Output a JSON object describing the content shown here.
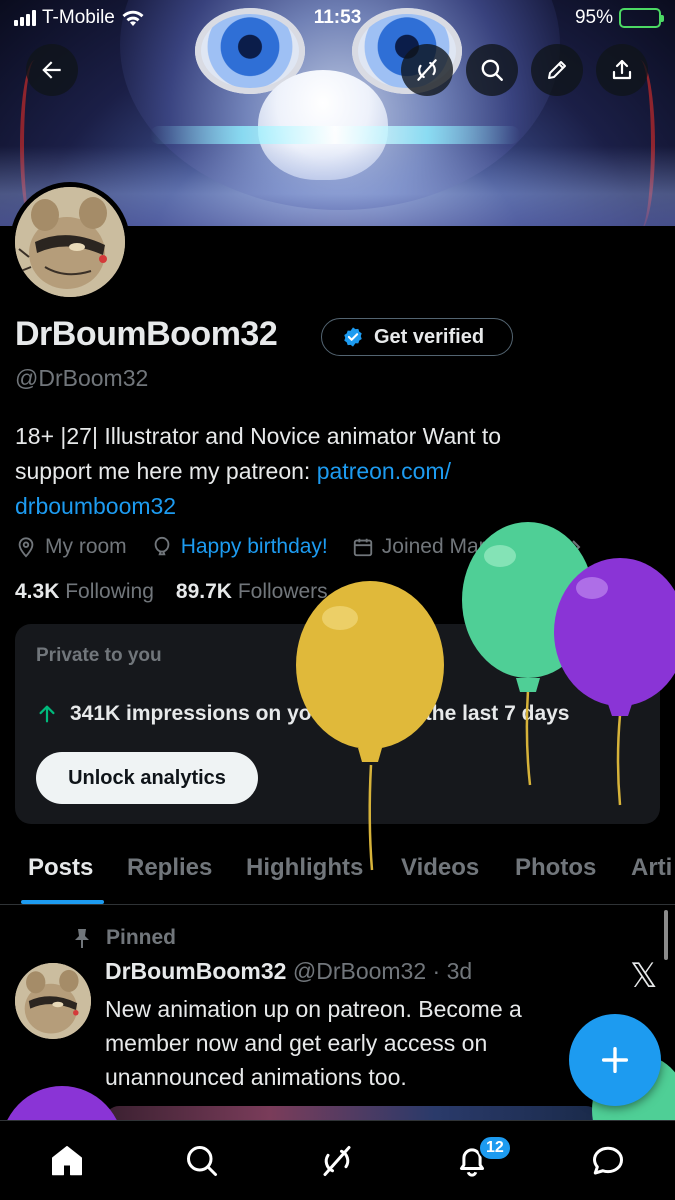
{
  "status_bar": {
    "carrier": "T-Mobile",
    "time": "11:53",
    "battery": "95%"
  },
  "header": {
    "back_icon": "arrow-left-icon",
    "grok_icon": "grok-icon",
    "search_icon": "search-icon",
    "edit_icon": "pencil-icon",
    "share_icon": "share-icon"
  },
  "profile": {
    "name": "DrBoumBoom32",
    "get_verified": "Get verified",
    "handle": "@DrBoom32",
    "bio_line1": "18+ |27| Illustrator and Novice animator Want to",
    "bio_line2_text": "support me here my patreon: ",
    "bio_link_part1": "patreon.com/",
    "bio_link_part2": "drboumboom32",
    "location": "My room",
    "birthday": "Happy birthday!",
    "joined": "Joined March 2019",
    "following_count": "4.3K",
    "following_label": "Following",
    "followers_count": "89.7K",
    "followers_label": "Followers"
  },
  "analytics_card": {
    "label": "Private to you",
    "impressions": "341K impressions on your posts in the last 7 days",
    "button": "Unlock analytics"
  },
  "tabs": [
    "Posts",
    "Replies",
    "Highlights",
    "Videos",
    "Photos",
    "Arti"
  ],
  "post": {
    "pinned": "Pinned",
    "author": "DrBoumBoom32",
    "handle_time": "@DrBoom32 · 3d",
    "text": "New animation up on patreon. Become a member now and get early access on unannounced animations too."
  },
  "bottom_nav": {
    "notifications_badge": "12"
  },
  "colors": {
    "accent": "#1d9bf0",
    "muted": "#71767b",
    "card": "#16181c",
    "impressions_arrow": "#00ba7c"
  }
}
